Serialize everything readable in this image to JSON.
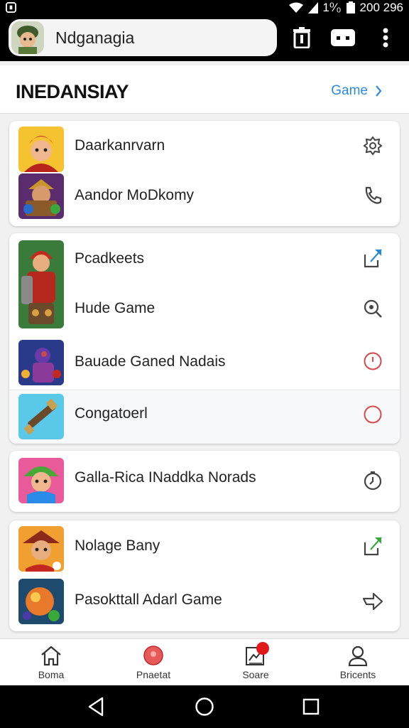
{
  "status_bar": {
    "battery_text": "1⁰⁄₀",
    "time": "200 296"
  },
  "search": {
    "query": "Ndganagia"
  },
  "header": {
    "title": "INEDANSIAY",
    "link_label": "Game"
  },
  "groups": [
    {
      "items": [
        {
          "label": "Daarkanrvarn",
          "thumb_icon": "hero-red-hair-icon",
          "action_icon": "settings-icon"
        },
        {
          "label": "Aandor MoDkomy",
          "thumb_icon": "warrior-treasure-icon",
          "action_icon": "phone-icon"
        }
      ]
    },
    {
      "items": [
        {
          "label": "Pcadkeets",
          "thumb_icon": "armored-knight-icon",
          "action_icon": "share-icon"
        },
        {
          "label": "Hude Game",
          "thumb_icon": "armored-knight-icon",
          "action_icon": "search-icon"
        },
        {
          "label": "Bauade Ganed Nadais",
          "thumb_icon": "blue-robot-icon",
          "action_icon": "circle-outline-icon"
        },
        {
          "label": "Congatoerl",
          "thumb_icon": "telescope-icon",
          "action_icon": "circle-outline-icon"
        }
      ]
    },
    {
      "items": [
        {
          "label": "Galla-Rica INaddka Norads",
          "thumb_icon": "green-hat-hero-icon",
          "action_icon": "timer-icon"
        }
      ]
    },
    {
      "items": [
        {
          "label": "Nolage Bany",
          "thumb_icon": "pirate-captain-icon",
          "action_icon": "share-icon"
        },
        {
          "label": "Pasokttall Adarl Game",
          "thumb_icon": "planet-orb-icon",
          "action_icon": "forward-icon"
        }
      ]
    }
  ],
  "bottom_nav": [
    {
      "label": "Boma",
      "icon": "home-icon"
    },
    {
      "label": "Pnaetat",
      "icon": "record-icon"
    },
    {
      "label": "Soare",
      "icon": "edit-box-icon",
      "badge": true
    },
    {
      "label": "Bricents",
      "icon": "profile-icon"
    }
  ],
  "colors": {
    "accent": "#2b8ad8",
    "badge": "#e01818",
    "warning_circle": "#d84a4a"
  }
}
